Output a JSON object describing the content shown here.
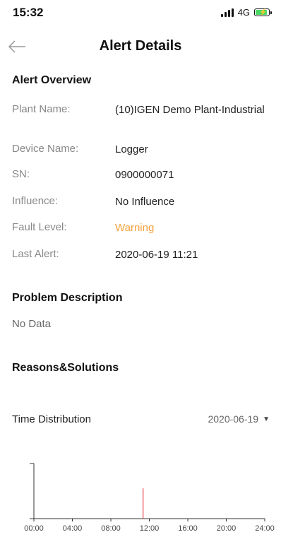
{
  "status": {
    "time": "15:32",
    "network": "4G"
  },
  "header": {
    "title": "Alert Details",
    "back_icon": "back-arrow-icon"
  },
  "overview": {
    "title": "Alert Overview",
    "rows": [
      {
        "label": "Plant Name:",
        "value": "(10)IGEN Demo Plant-Industrial"
      },
      {
        "label": "Device Name:",
        "value": "Logger"
      },
      {
        "label": "SN:",
        "value": "0900000071"
      },
      {
        "label": "Influence:",
        "value": "No Influence"
      },
      {
        "label": "Fault Level:",
        "value": "Warning"
      },
      {
        "label": "Last Alert:",
        "value": "2020-06-19 11:21"
      }
    ]
  },
  "problem": {
    "title": "Problem Description",
    "text": "No Data"
  },
  "reasons": {
    "title": "Reasons&Solutions"
  },
  "time_distribution": {
    "title": "Time Distribution",
    "date": "2020-06-19"
  },
  "colors": {
    "warning": "#f5a13b",
    "event_line": "#e8484d",
    "battery": "#4cd964"
  },
  "chart_data": {
    "type": "bar",
    "x_ticks": [
      "00:00",
      "04:00",
      "08:00",
      "12:00",
      "16:00",
      "20:00",
      "24:00"
    ],
    "xlim": [
      0,
      24
    ],
    "events": [
      {
        "x": 11.35,
        "value": 0.55
      }
    ],
    "ylim": [
      0,
      1
    ],
    "grid": false
  }
}
